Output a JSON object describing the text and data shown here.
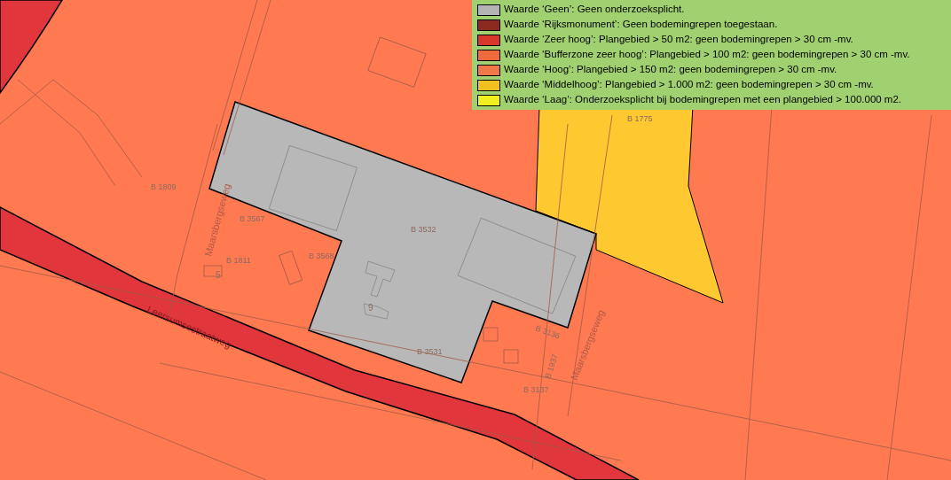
{
  "legend": {
    "items": [
      {
        "label": "Waarde ‘Geen’: Geen onderzoeksplicht.",
        "color": "#b4b4b4"
      },
      {
        "label": "Waarde ‘Rijksmonument’: Geen bodemingrepen toegestaan.",
        "color": "#8b2a1f"
      },
      {
        "label": "Waarde ‘Zeer hoog’: Plangebied > 50 m2: geen bodemingrepen > 30 cm -mv.",
        "color": "#d8382a"
      },
      {
        "label": "Waarde ‘Bufferzone zeer hoog’: Plangebied > 100 m2: geen bodemingrepen > 30 cm -mv.",
        "color": "#f06a3c"
      },
      {
        "label": "Waarde ‘Hoog’: Plangebied > 150 m2: geen bodemingrepen > 30 cm -mv.",
        "color": "#f07848"
      },
      {
        "label": "Waarde ‘Middelhoog’: Plangebied > 1.000 m2: geen bodemingrepen > 30 cm -mv.",
        "color": "#f0c020"
      },
      {
        "label": "Waarde ‘Laag’: Onderzoeksplicht bij bodemingrepen met een plangebied > 100.000 m2.",
        "color": "#f0f020"
      }
    ]
  },
  "map": {
    "parcels": [
      "B 1809",
      "B 3567",
      "B 1811",
      "B 3568",
      "B 3532",
      "B 3531",
      "B 3136",
      "B 3137",
      "B 1937",
      "B 1775"
    ],
    "streets": [
      "Maarsbergseweg",
      "Leersumsestraatweg",
      "Maarsbergseweg"
    ],
    "house_numbers": [
      "5",
      "9"
    ]
  }
}
